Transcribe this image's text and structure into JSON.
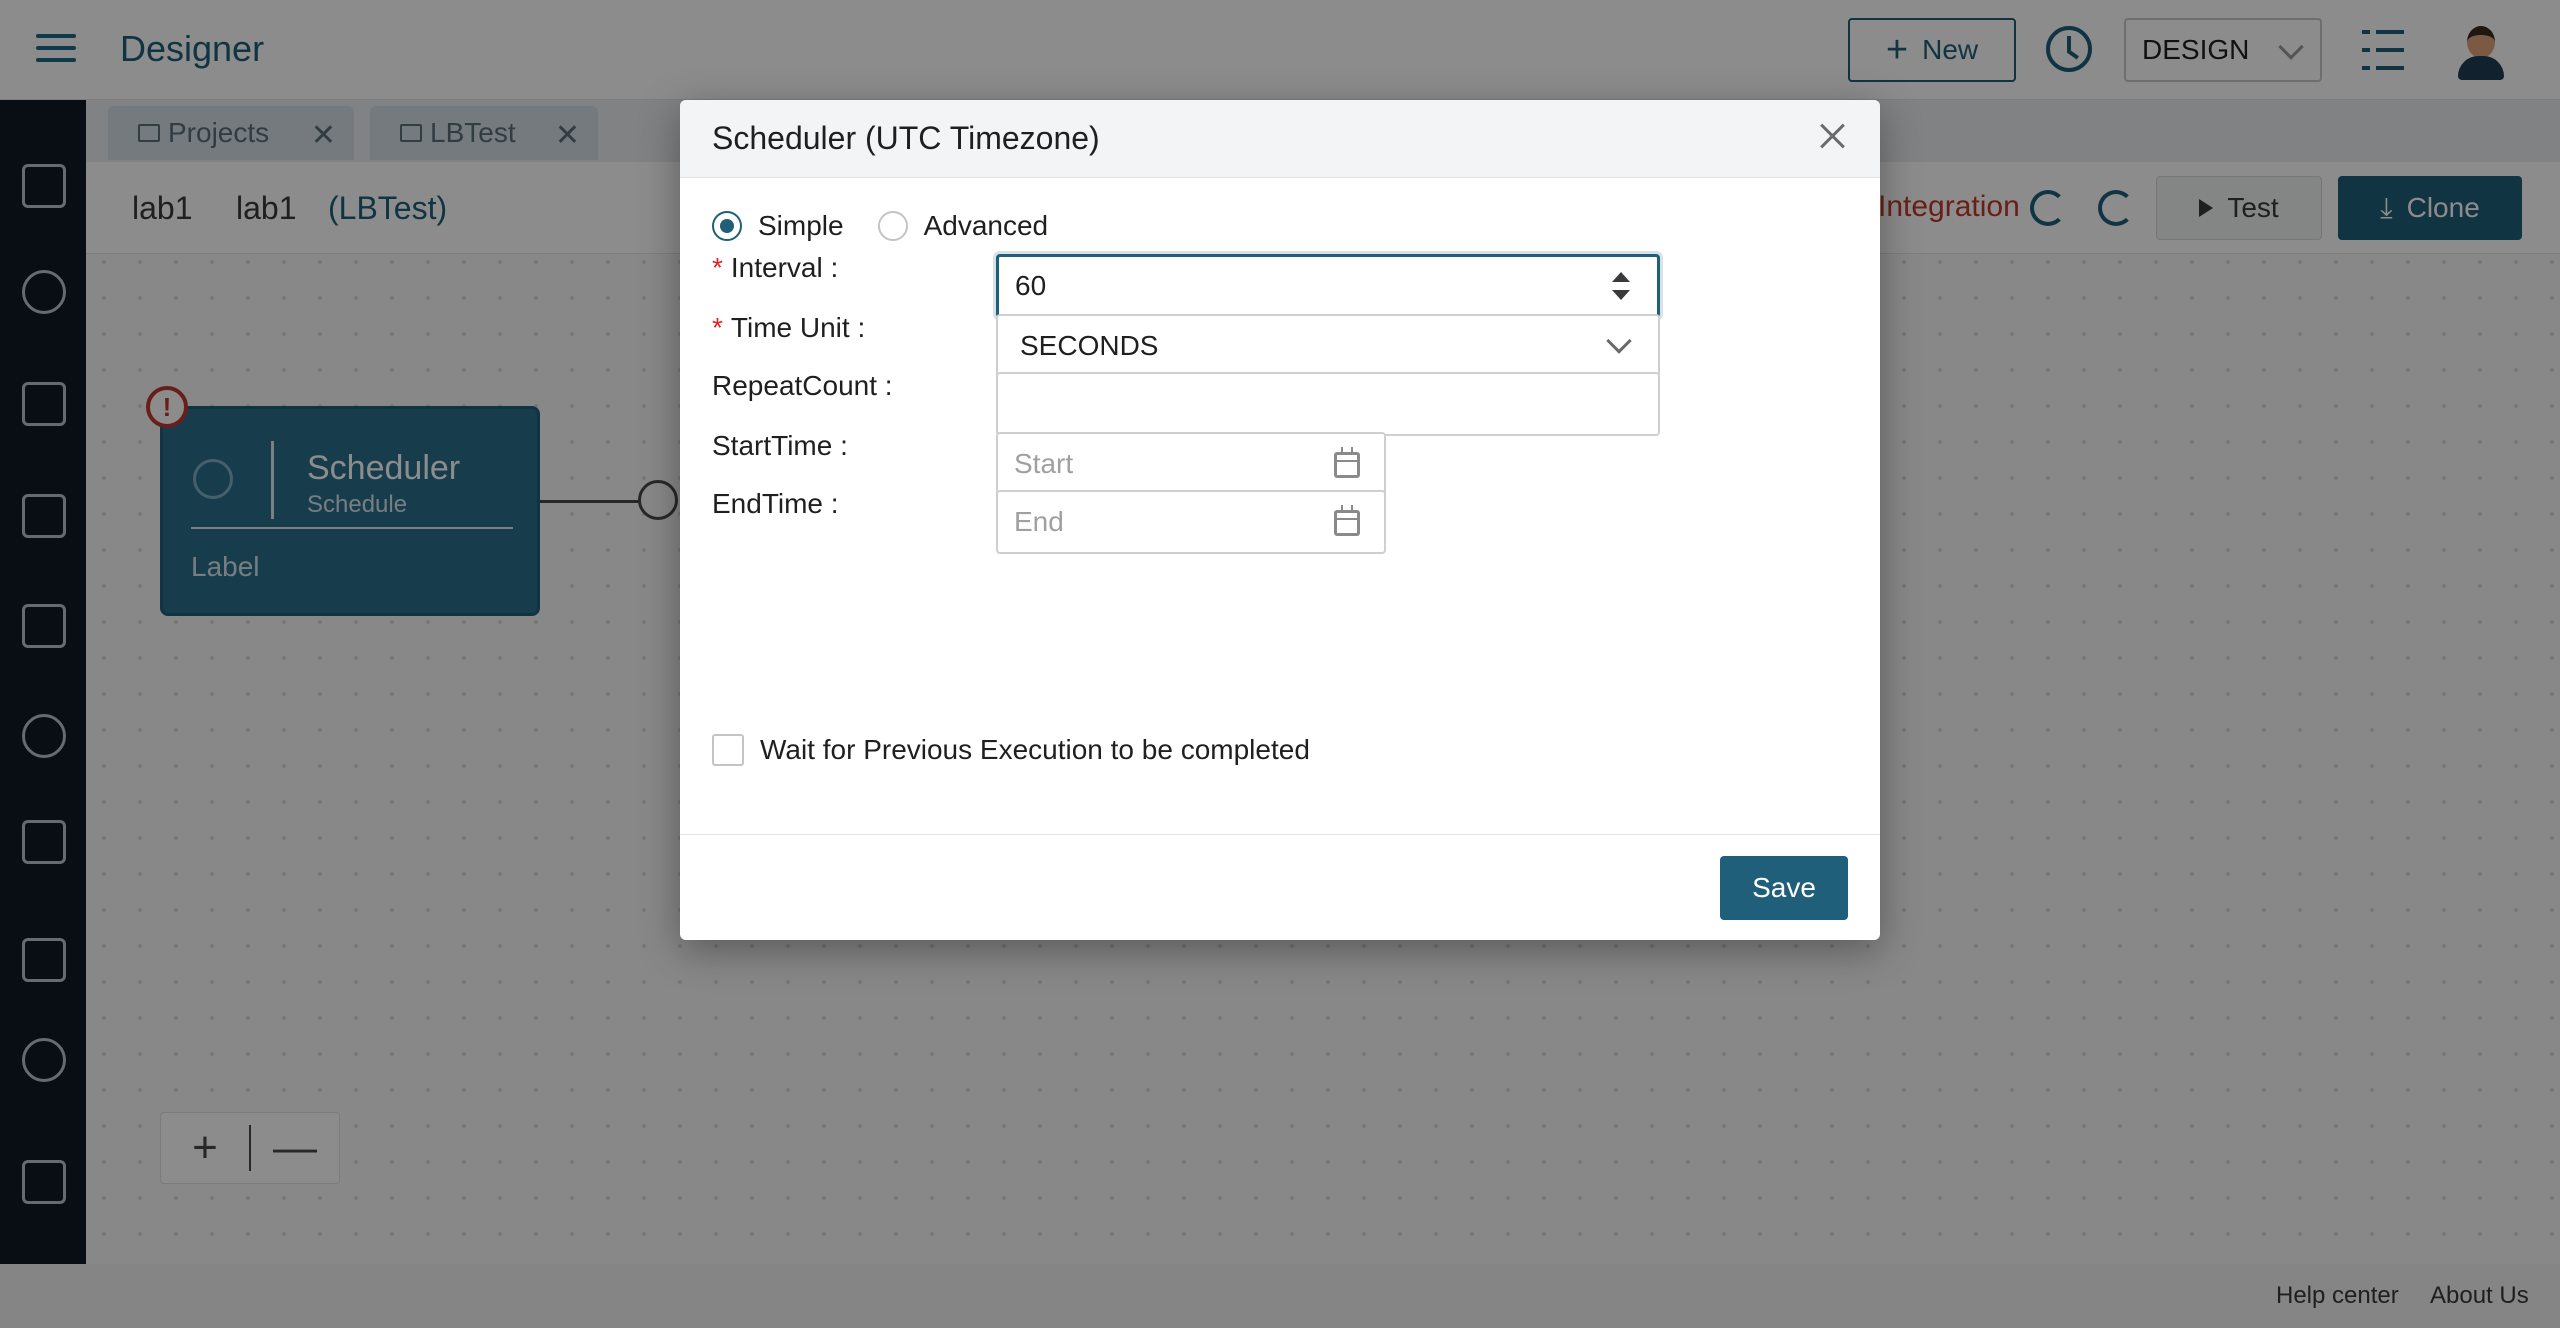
{
  "app": {
    "title": "Designer"
  },
  "header": {
    "new_label": "New",
    "mode_value": "DESIGN"
  },
  "tabs": [
    {
      "label": "Projects"
    },
    {
      "label": "LBTest"
    }
  ],
  "toolbar": {
    "crumb1": "lab1",
    "crumb2": "lab1",
    "project": "(LBTest)",
    "integration_label": "Integration",
    "test_label": "Test",
    "clone_label": "Clone"
  },
  "node": {
    "title": "Scheduler",
    "subtitle": "Schedule",
    "label": "Label",
    "alert": "!"
  },
  "zoom": {
    "plus": "+",
    "minus": "—"
  },
  "footer": {
    "help": "Help center",
    "about": "About Us"
  },
  "modal": {
    "title": "Scheduler (UTC Timezone)",
    "mode_options": [
      "Simple",
      "Advanced"
    ],
    "mode_selected": "Simple",
    "interval_label": "Interval",
    "interval_value": "60",
    "timeunit_label": "Time Unit",
    "timeunit_value": "SECONDS",
    "repeat_label": "RepeatCount",
    "repeat_value": "",
    "start_label": "StartTime",
    "start_placeholder": "Start",
    "end_label": "EndTime",
    "end_placeholder": "End",
    "wait_label": "Wait for Previous Execution to be completed",
    "wait_checked": false,
    "save_label": "Save"
  },
  "colors": {
    "primary": "#1f5f7a",
    "required": "#e02424",
    "sidebar": "#0f1b24"
  }
}
